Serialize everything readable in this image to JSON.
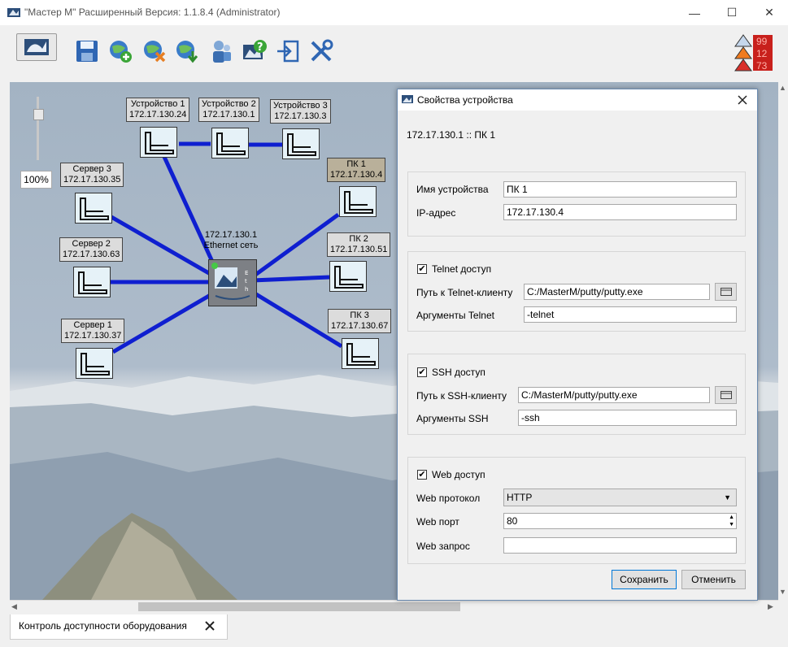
{
  "window": {
    "title": "\"Мастер М\" Расширенный Версия: 1.1.8.4 (Administrator)"
  },
  "zoom": {
    "label": "100%"
  },
  "alerts": {
    "critical": "99",
    "warning": "12",
    "info": "73"
  },
  "network": {
    "hub": {
      "ip": "172.17.130.1",
      "name": "Ethernet сеть"
    },
    "devices": [
      {
        "name": "Устройство 1",
        "ip": "172.17.130.24"
      },
      {
        "name": "Устройство 2",
        "ip": "172.17.130.1"
      },
      {
        "name": "Устройство 3",
        "ip": "172.17.130.3"
      },
      {
        "name": "Сервер 3",
        "ip": "172.17.130.35"
      },
      {
        "name": "Сервер 2",
        "ip": "172.17.130.63"
      },
      {
        "name": "Сервер 1",
        "ip": "172.17.130.37"
      },
      {
        "name": "ПК 1",
        "ip": "172.17.130.4"
      },
      {
        "name": "ПК 2",
        "ip": "172.17.130.51"
      },
      {
        "name": "ПК 3",
        "ip": "172.17.130.67"
      }
    ]
  },
  "bottom_tab": {
    "label": "Контроль доступности оборудования"
  },
  "dialog": {
    "title": "Свойства устройства",
    "header": "172.17.130.1 :: ПК 1",
    "name_label": "Имя устройства",
    "name_value": "ПК 1",
    "ip_label": "IP-адрес",
    "ip_value": "172.17.130.4",
    "telnet_label": "Telnet доступ",
    "telnet_path_label": "Путь к Telnet-клиенту",
    "telnet_path_value": "C:/MasterM/putty/putty.exe",
    "telnet_args_label": "Аргументы Telnet",
    "telnet_args_value": "-telnet",
    "ssh_label": "SSH доступ",
    "ssh_path_label": "Путь к SSH-клиенту",
    "ssh_path_value": "C:/MasterM/putty/putty.exe",
    "ssh_args_label": "Аргументы SSH",
    "ssh_args_value": "-ssh",
    "web_label": "Web доступ",
    "web_protocol_label": "Web протокол",
    "web_protocol_value": "HTTP",
    "web_port_label": "Web порт",
    "web_port_value": "80",
    "web_request_label": "Web запрос",
    "web_request_value": "",
    "save_label": "Сохранить",
    "cancel_label": "Отменить"
  }
}
